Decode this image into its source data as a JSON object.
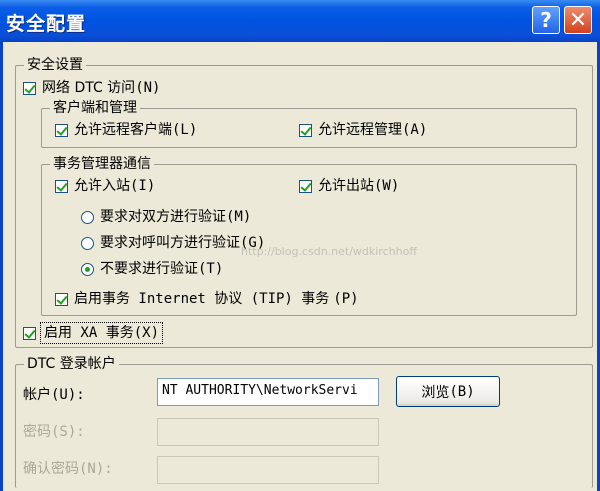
{
  "window": {
    "title": "安全配置"
  },
  "titlebar_buttons": {
    "help": "?",
    "close": "✕"
  },
  "security_settings": {
    "legend": "安全设置",
    "network_dtc_access": {
      "label": "网络 DTC 访问",
      "hotkey": "(N)",
      "checked": true
    },
    "client_admin": {
      "legend": "客户端和管理",
      "allow_remote_clients": {
        "label": "允许远程客户端",
        "hotkey": "(L)",
        "checked": true
      },
      "allow_remote_admin": {
        "label": "允许远程管理",
        "hotkey": "(A)",
        "checked": true
      }
    },
    "tm_communication": {
      "legend": "事务管理器通信",
      "allow_inbound": {
        "label": "允许入站",
        "hotkey": "(I)",
        "checked": true
      },
      "allow_outbound": {
        "label": "允许出站",
        "hotkey": "(W)",
        "checked": true
      },
      "auth_options": [
        {
          "label": "要求对双方进行验证",
          "hotkey": "(M)",
          "selected": false
        },
        {
          "label": "要求对呼叫方进行验证",
          "hotkey": "(G)",
          "selected": false
        },
        {
          "label": "不要求进行验证",
          "hotkey": "(T)",
          "selected": true
        }
      ],
      "enable_tip": {
        "label": "启用事务 Internet 协议 (TIP) 事务",
        "hotkey": "(P)",
        "checked": true
      }
    },
    "enable_xa": {
      "label": "启用 XA 事务",
      "hotkey": "(X)",
      "checked": true
    }
  },
  "dtc_logon": {
    "legend": "DTC 登录帐户",
    "account_label": "帐户",
    "account_hotkey": "(U):",
    "account_value": "NT AUTHORITY\\NetworkServi",
    "browse_label": "浏览",
    "browse_hotkey": "(B)",
    "password_label": "密码",
    "password_hotkey": "(S):",
    "confirm_label": "确认密码",
    "confirm_hotkey": "(N):"
  },
  "watermark": "http://blog.csdn.net/wdkirchhoff"
}
